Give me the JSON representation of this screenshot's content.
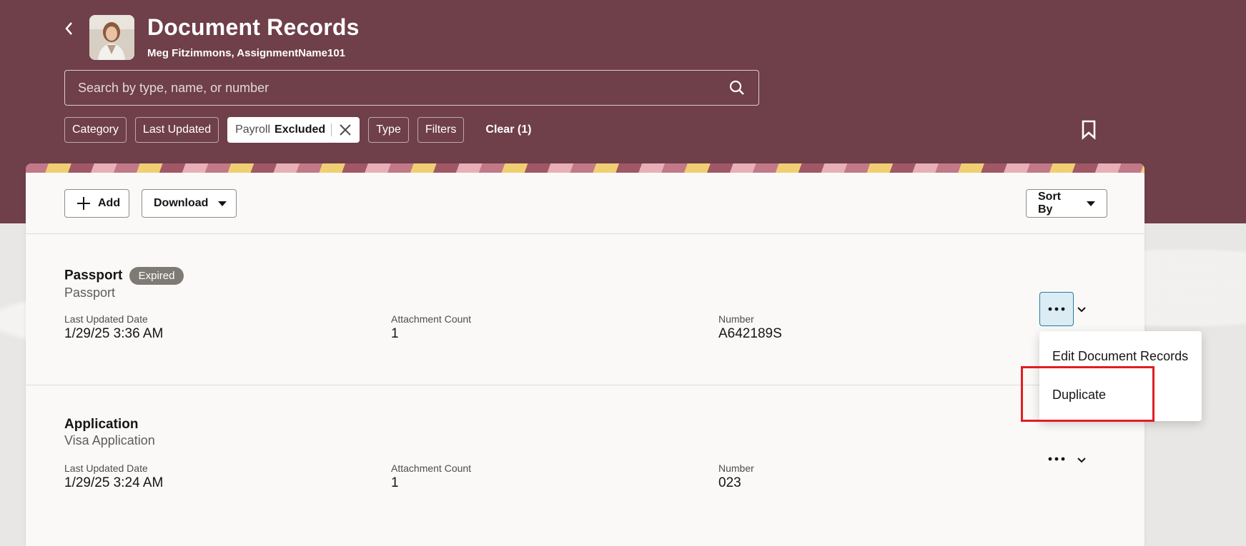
{
  "header": {
    "title": "Document Records",
    "subtitle": "Meg Fitzimmons, AssignmentName101"
  },
  "search": {
    "placeholder": "Search by type, name, or number",
    "value": ""
  },
  "filters": {
    "category": "Category",
    "last_updated": "Last Updated",
    "active": {
      "label": "Payroll",
      "value": "Excluded"
    },
    "type": "Type",
    "filters": "Filters",
    "clear": "Clear (1)"
  },
  "toolbar": {
    "add": "Add",
    "download": "Download",
    "sort_by": "Sort By"
  },
  "records": [
    {
      "title": "Passport",
      "badge": "Expired",
      "subtitle": "Passport",
      "last_updated_label": "Last Updated Date",
      "last_updated": "1/29/25 3:36 AM",
      "attachment_label": "Attachment Count",
      "attachment_count": "1",
      "number_label": "Number",
      "number": "A642189S"
    },
    {
      "title": "Application",
      "subtitle": "Visa Application",
      "last_updated_label": "Last Updated Date",
      "last_updated": "1/29/25 3:24 AM",
      "attachment_label": "Attachment Count",
      "attachment_count": "1",
      "number_label": "Number",
      "number": "023"
    }
  ],
  "menu": {
    "edit": "Edit Document Records",
    "duplicate": "Duplicate"
  },
  "colors": {
    "header": "#6f3f4a",
    "highlight": "#e11d23",
    "badge": "#7e7a74"
  }
}
